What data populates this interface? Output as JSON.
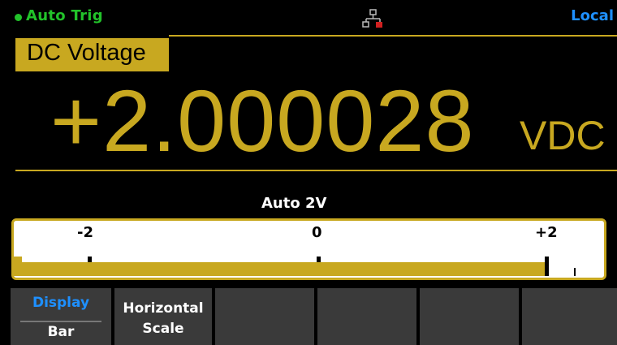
{
  "status": {
    "trigger": "Auto Trig",
    "remote_state": "Local",
    "network_icon": "lan-disconnected-icon"
  },
  "measurement": {
    "function": "DC Voltage",
    "reading": "+2.000028",
    "unit": "VDC",
    "range_label": "Auto 2V"
  },
  "bar_scale": {
    "labels": [
      "-2",
      "0",
      "+2"
    ],
    "min": -2,
    "max": 2,
    "value": 2.000028
  },
  "softkeys": {
    "display": {
      "title": "Display",
      "value": "Bar"
    },
    "horizontal_scale": {
      "line1": "Horizontal",
      "line2": "Scale"
    }
  },
  "colors": {
    "accent": "#c8a820",
    "trigger_green": "#22c22a",
    "local_blue": "#1e90ff",
    "softkey_bg": "#3a3a3a"
  }
}
